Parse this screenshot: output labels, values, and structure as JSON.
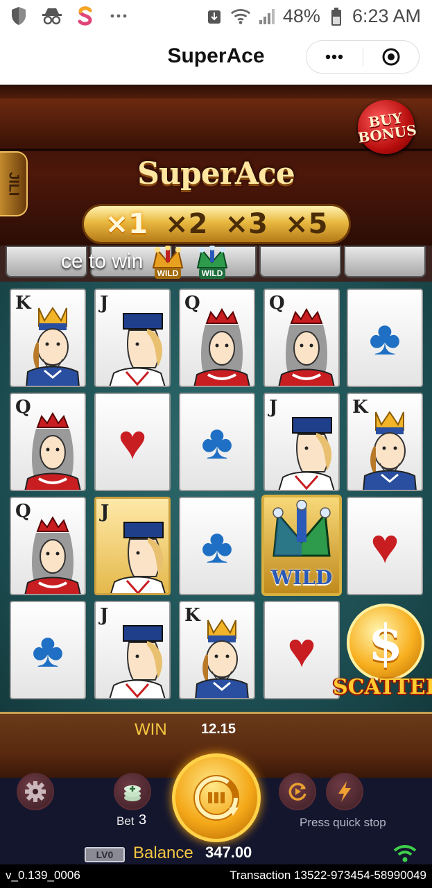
{
  "status_bar": {
    "battery": "48%",
    "time": "6:23 AM"
  },
  "app_bar": {
    "title": "SuperAce"
  },
  "game": {
    "logo": "SuperAce",
    "buy_bonus": [
      "BUY",
      "BONUS"
    ],
    "side_tab": "JILI",
    "multipliers": [
      "×1",
      "×2",
      "×3",
      "×5"
    ],
    "active_multiplier_index": 0,
    "hint": "ce to win",
    "hint_badges": [
      "WILD",
      "WILD"
    ],
    "reels": [
      [
        {
          "rank": "K",
          "type": "king"
        },
        {
          "rank": "J",
          "type": "jack"
        },
        {
          "rank": "Q",
          "type": "queen"
        },
        {
          "rank": "Q",
          "type": "queen"
        },
        {
          "rank": "",
          "type": "club"
        }
      ],
      [
        {
          "rank": "Q",
          "type": "queen"
        },
        {
          "rank": "",
          "type": "heart"
        },
        {
          "rank": "",
          "type": "club"
        },
        {
          "rank": "J",
          "type": "jack"
        },
        {
          "rank": "K",
          "type": "king"
        }
      ],
      [
        {
          "rank": "Q",
          "type": "queen"
        },
        {
          "rank": "J",
          "type": "jack-gold"
        },
        {
          "rank": "",
          "type": "club"
        },
        {
          "rank": "WILD",
          "type": "wild"
        },
        {
          "rank": "",
          "type": "heart"
        }
      ],
      [
        {
          "rank": "",
          "type": "club"
        },
        {
          "rank": "J",
          "type": "jack"
        },
        {
          "rank": "K",
          "type": "king"
        },
        {
          "rank": "",
          "type": "heart"
        },
        {
          "rank": "SCATTER",
          "type": "scatter"
        }
      ]
    ],
    "scatter_label": "SCATTER"
  },
  "controls": {
    "win_label": "WIN",
    "win_value": "12.15",
    "bet_label": "Bet",
    "bet_value": "3",
    "quick_stop_label": "Press quick stop",
    "level_badge": "LV0",
    "balance_label": "Balance",
    "balance_value": "347.00"
  },
  "footer": {
    "version": "v_0.139_0006",
    "transaction": "Transaction 13522-973454-58990049"
  },
  "colors": {
    "felt": "#1c4c50",
    "gold": "#f5c742",
    "club": "#1f6fc4",
    "heart": "#c81e22"
  }
}
